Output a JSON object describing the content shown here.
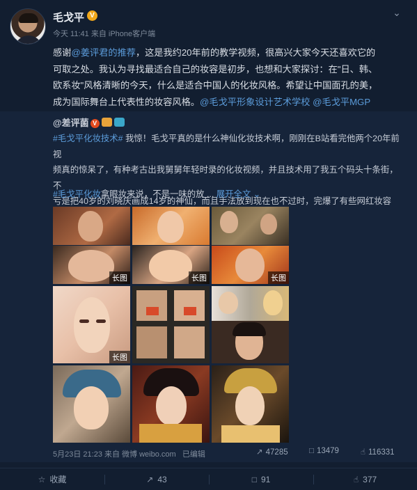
{
  "post": {
    "username": "毛戈平",
    "verified_mark": "V",
    "meta": "今天 11:41 来自 iPhone客户端",
    "text": {
      "l1a": "感谢",
      "l1link": "@姜评君的推荐",
      "l1b": "，这是我约20年前的教学视频，很高兴大家今天还喜欢它的",
      "l2": "可取之处。我认为寻找最适合自己的妆容是初步，也想和大家探讨：在\"日、韩、",
      "l3": "欧系妆\"风格清晰的今天，什么是适合中国人的化妆风格。希望让中国面孔的美，",
      "l4a": "成为国际舞台上代表性的妆容风格。",
      "l4link1": "@毛戈平形象设计艺术学校",
      "l4link2": "@毛戈平MGP"
    }
  },
  "repost": {
    "author": "@差评菌",
    "badge": "V",
    "hashtag1": "#毛戈平化妆技术#",
    "text1a": " 我惊！毛戈平真的是什么神仙化妆技术啊，刚刚在B站看完他两个20年前视",
    "text1b": "频真的惊呆了，有种考古出我舅舅年轻时录的化妆视频，并且技术用了我五个码头十条街，不",
    "text1c": "亏是把40岁的刘晓庆画成14岁的神仙，而且手法放到现在也不过时，完爆了有些网红妆容",
    "hashtag2": "#毛戈平化妆",
    "text2": "拿眼妆来说，不是一味的放 ...",
    "expand": "展开全文",
    "expand_icon": "chevron-down-icon",
    "long_image_tag": "长图",
    "footer": "5月23日 21:23 来自 微博 weibo.com",
    "edited": "已编辑",
    "stats": {
      "repost": "47285",
      "comment": "13479",
      "like": "116331"
    }
  },
  "actions": {
    "favorite": "收藏",
    "repost": "43",
    "comment": "91",
    "like": "377"
  },
  "colors": {
    "link": "#5b9bd9",
    "bg": "#121e30",
    "repost_bg": "#16243a"
  }
}
